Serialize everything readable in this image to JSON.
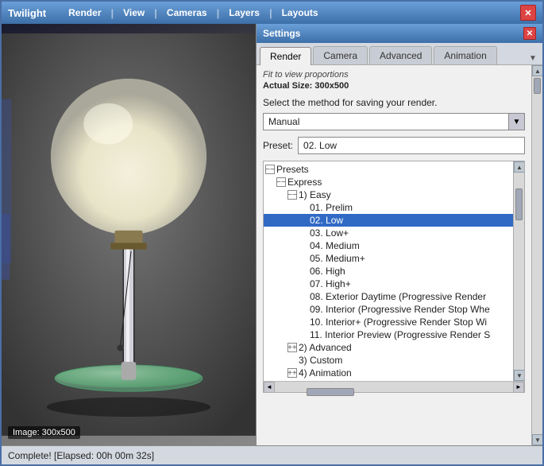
{
  "window": {
    "title": "Twilight",
    "close_label": "✕"
  },
  "menu": {
    "items": [
      {
        "label": "Render"
      },
      {
        "label": "View"
      },
      {
        "label": "Cameras"
      },
      {
        "label": "Layers"
      },
      {
        "label": "Layouts"
      }
    ]
  },
  "settings": {
    "title": "Settings",
    "close_label": "✕"
  },
  "tabs": [
    {
      "label": "Render",
      "active": true
    },
    {
      "label": "Camera",
      "active": false
    },
    {
      "label": "Advanced",
      "active": false
    },
    {
      "label": "Animation",
      "active": false
    }
  ],
  "content": {
    "info_text": "Fit to view proportions",
    "actual_size": "Actual Size: 300x500",
    "save_method_label": "Select the method for saving your render.",
    "dropdown_value": "Manual",
    "preset_label": "Preset:",
    "preset_value": "02. Low"
  },
  "tree": {
    "items": [
      {
        "indent": 0,
        "expand": "minus",
        "label": "Presets",
        "selected": false
      },
      {
        "indent": 1,
        "expand": "minus",
        "label": "Express",
        "selected": false
      },
      {
        "indent": 2,
        "expand": "minus",
        "label": "1) Easy",
        "selected": false
      },
      {
        "indent": 3,
        "expand": "none",
        "label": "01. Prelim",
        "selected": false
      },
      {
        "indent": 3,
        "expand": "none",
        "label": "02. Low",
        "selected": true
      },
      {
        "indent": 3,
        "expand": "none",
        "label": "03. Low+",
        "selected": false
      },
      {
        "indent": 3,
        "expand": "none",
        "label": "04. Medium",
        "selected": false
      },
      {
        "indent": 3,
        "expand": "none",
        "label": "05. Medium+",
        "selected": false
      },
      {
        "indent": 3,
        "expand": "none",
        "label": "06. High",
        "selected": false
      },
      {
        "indent": 3,
        "expand": "none",
        "label": "07. High+",
        "selected": false
      },
      {
        "indent": 3,
        "expand": "none",
        "label": "08. Exterior Daytime (Progressive Render",
        "selected": false
      },
      {
        "indent": 3,
        "expand": "none",
        "label": "09. Interior (Progressive Render Stop Whe",
        "selected": false
      },
      {
        "indent": 3,
        "expand": "none",
        "label": "10. Interior+ (Progressive Render Stop Wi",
        "selected": false
      },
      {
        "indent": 3,
        "expand": "none",
        "label": "11. Interior Preview (Progressive Render S",
        "selected": false
      },
      {
        "indent": 2,
        "expand": "plus",
        "label": "2) Advanced",
        "selected": false
      },
      {
        "indent": 2,
        "expand": "none",
        "label": "3) Custom",
        "selected": false
      },
      {
        "indent": 2,
        "expand": "plus",
        "label": "4) Animation",
        "selected": false
      }
    ]
  },
  "status": {
    "text": "Complete!  [Elapsed: 00h 00m 32s]"
  },
  "render_label": "Image: 300x500"
}
